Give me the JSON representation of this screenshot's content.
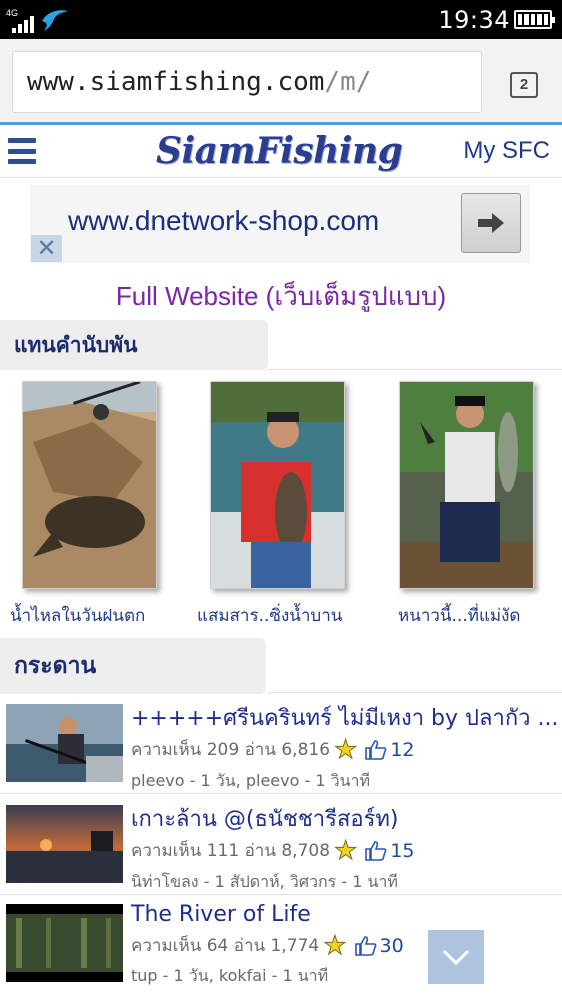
{
  "status_bar": {
    "network": "4G",
    "time": "19:34",
    "icons": [
      "signal-icon",
      "carrier-bird-icon",
      "battery-icon"
    ]
  },
  "browser": {
    "url_host": "www.siamfishing.com",
    "url_path": "/m/",
    "tab_count": "2"
  },
  "header": {
    "logo": "SiamFishing",
    "my_sfc": "My SFC"
  },
  "ad": {
    "text": "www.dnetwork-shop.com",
    "close_label": "✕"
  },
  "full_website_link": "Full Website (เว็บเต็มรูปแบบ)",
  "featured_section": {
    "title": "แทนคำนับพัน",
    "items": [
      {
        "caption": "น้ำไหลในวันฝนตก"
      },
      {
        "caption": "แสมสาร..ซิ่งน้ำบาน"
      },
      {
        "caption": "หนาวนี้...ที่แม่งัด"
      }
    ]
  },
  "board_section": {
    "title": "กระดาน",
    "threads": [
      {
        "title": "+++++ศรีนครินทร์ ไม่มีเหงา by ปลากัว ...",
        "stats": "ความเห็น 209 อ่าน 6,816",
        "likes": "12",
        "meta": "pleevo - 1 วัน, pleevo - 1 วินาที"
      },
      {
        "title": "เกาะล้าน @(ธนัชชารีสอร์ท)",
        "stats": "ความเห็น 111 อ่าน 8,708",
        "likes": "15",
        "meta": "นิท่าโขลง - 1 สัปดาห์, วิศวกร - 1 นาที"
      },
      {
        "title": "The River of Life",
        "stats": "ความเห็น 64 อ่าน 1,774",
        "likes": "30",
        "meta": "tup - 1 วัน, kokfai - 1 นาที"
      }
    ]
  },
  "colors": {
    "brand_blue": "#2a3d8f",
    "link_purple": "#7a27a6",
    "title_blue": "#1d2f8a",
    "accent_line": "#5b9bd5"
  }
}
